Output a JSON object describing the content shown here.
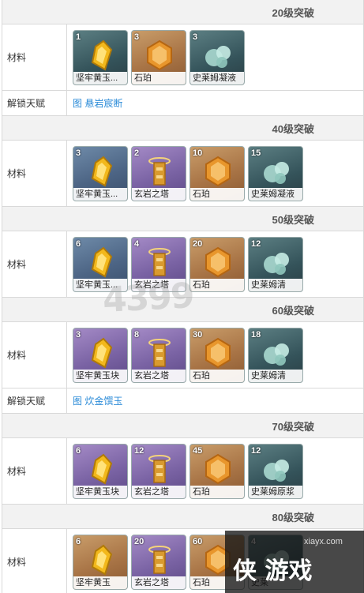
{
  "labels": {
    "materials": "材料",
    "unlock_talent": "解锁天赋"
  },
  "sections": [
    {
      "stage": "20级突破",
      "items": [
        {
          "count": "1",
          "name": "坚牢黄玉...",
          "style": "g",
          "icon": "topaz-sliver-icon"
        },
        {
          "count": "3",
          "name": "石珀",
          "style": "o",
          "icon": "amber-icon"
        },
        {
          "count": "3",
          "name": "史莱姆凝液",
          "style": "g",
          "icon": "slime-condensate-icon"
        }
      ],
      "talent": "图  悬岩宸断"
    },
    {
      "stage": "40级突破",
      "items": [
        {
          "count": "3",
          "name": "坚牢黄玉...",
          "style": "b",
          "icon": "topaz-fragment-icon"
        },
        {
          "count": "2",
          "name": "玄岩之塔",
          "style": "p",
          "icon": "basalt-pillar-icon"
        },
        {
          "count": "10",
          "name": "石珀",
          "style": "o",
          "icon": "amber-icon"
        },
        {
          "count": "15",
          "name": "史莱姆凝液",
          "style": "g",
          "icon": "slime-condensate-icon"
        }
      ]
    },
    {
      "stage": "50级突破",
      "items": [
        {
          "count": "6",
          "name": "坚牢黄玉...",
          "style": "b",
          "icon": "topaz-fragment-icon"
        },
        {
          "count": "4",
          "name": "玄岩之塔",
          "style": "p",
          "icon": "basalt-pillar-icon"
        },
        {
          "count": "20",
          "name": "石珀",
          "style": "o",
          "icon": "amber-icon"
        },
        {
          "count": "12",
          "name": "史莱姆清",
          "style": "g",
          "icon": "slime-secretions-icon"
        }
      ]
    },
    {
      "stage": "60级突破",
      "items": [
        {
          "count": "3",
          "name": "坚牢黄玉块",
          "style": "p",
          "icon": "topaz-chunk-icon"
        },
        {
          "count": "8",
          "name": "玄岩之塔",
          "style": "p",
          "icon": "basalt-pillar-icon"
        },
        {
          "count": "30",
          "name": "石珀",
          "style": "o",
          "icon": "amber-icon"
        },
        {
          "count": "18",
          "name": "史莱姆清",
          "style": "g",
          "icon": "slime-secretions-icon"
        }
      ],
      "talent": "图  炊金馔玉"
    },
    {
      "stage": "70级突破",
      "items": [
        {
          "count": "6",
          "name": "坚牢黄玉块",
          "style": "p",
          "icon": "topaz-chunk-icon"
        },
        {
          "count": "12",
          "name": "玄岩之塔",
          "style": "p",
          "icon": "basalt-pillar-icon"
        },
        {
          "count": "45",
          "name": "石珀",
          "style": "o",
          "icon": "amber-icon"
        },
        {
          "count": "12",
          "name": "史莱姆原浆",
          "style": "g",
          "icon": "slime-concentrate-icon"
        }
      ]
    },
    {
      "stage": "80级突破",
      "items": [
        {
          "count": "6",
          "name": "坚牢黄玉",
          "style": "o",
          "icon": "topaz-gemstone-icon"
        },
        {
          "count": "20",
          "name": "玄岩之塔",
          "style": "p",
          "icon": "basalt-pillar-icon"
        },
        {
          "count": "60",
          "name": "石珀",
          "style": "o",
          "icon": "amber-icon"
        },
        {
          "count": "4",
          "name": "史莱",
          "style": "g",
          "icon": "slime-concentrate-icon"
        }
      ]
    }
  ],
  "colors": {
    "link": "#2b8bd8",
    "stage_bg": "#f2f2f2",
    "border": "#d9d9d9",
    "gem_yellow": "#f2b81c",
    "amber_orange": "#e8962c",
    "slime_teal": "#a8d8cf"
  },
  "watermarks": {
    "site1": "4399",
    "site2": "xiayx.com",
    "logo": "侠 游戏"
  }
}
